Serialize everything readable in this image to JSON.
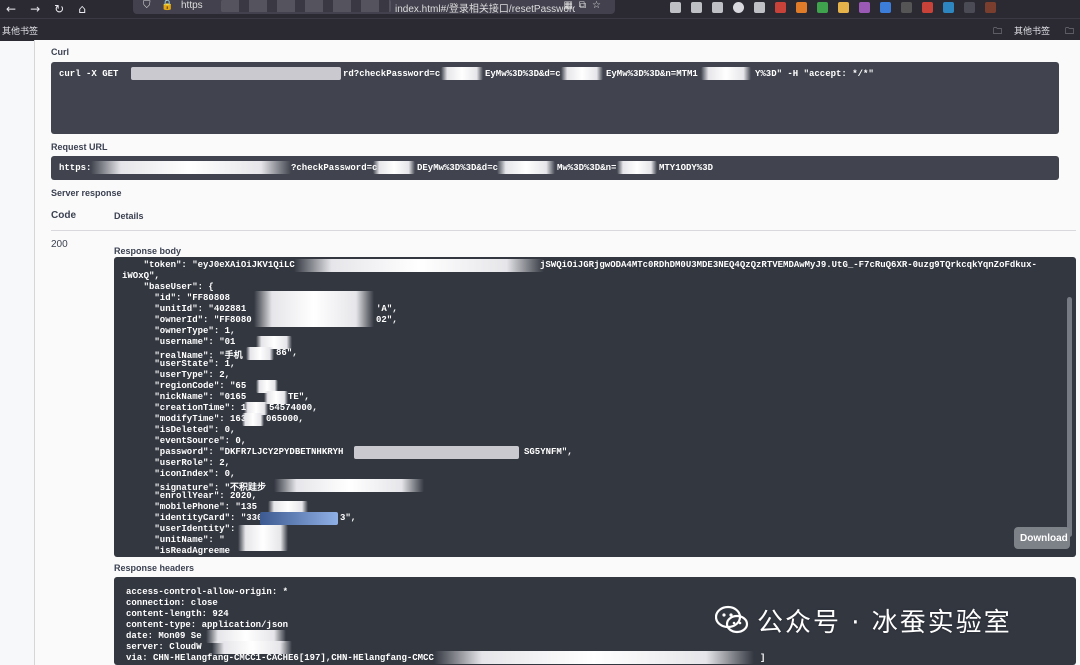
{
  "browser": {
    "nav": {
      "back": "←",
      "forward": "→",
      "reload": "↻",
      "home": "⌂"
    },
    "url_scheme": "https",
    "url_path": "index.html#/登录相关接口/resetPasswordUsi"
  },
  "bookmarks": {
    "left_label": "其他书签",
    "right_label": "其他书签"
  },
  "curl": {
    "label": "Curl",
    "cmd_start": "curl -X GET",
    "seg_a": "rd?checkPassword=c",
    "seg_b": "EyMw%3D%3D&d=c",
    "seg_c": "EyMw%3D%3D&n=MTM1",
    "seg_d": "Y%3D\" -H \"accept: */*\""
  },
  "request_url": {
    "label": "Request URL",
    "scheme": "https:",
    "seg_a": "?checkPassword=c",
    "seg_b": "DEyMw%3D%3D&d=c",
    "seg_c": "Mw%3D%3D&n=",
    "seg_d": "MTY1ODY%3D"
  },
  "server_response": {
    "label": "Server response",
    "code_header": "Code",
    "details_header": "Details",
    "code": "200",
    "body_label": "Response body",
    "download_label": "Download",
    "headers_label": "Response headers"
  },
  "response_body": {
    "lines": [
      "    \"token\": \"eyJ0eXAiOiJKV1QiLC",
      "iWOxQ\",",
      "    \"baseUser\": {",
      "      \"id\": \"FF80808",
      "      \"unitId\": \"402881",
      "      \"ownerId\": \"FF8080",
      "      \"ownerType\": 1,",
      "      \"username\": \"01",
      "      \"realName\": \"手机",
      "      \"userState\": 1,",
      "      \"userType\": 2,",
      "      \"regionCode\": \"65",
      "      \"nickName\": \"0165",
      "      \"creationTime\": 1",
      "      \"modifyTime\": 163",
      "      \"isDeleted\": 0,",
      "      \"eventSource\": 0,",
      "      \"password\": \"DKFR7LJCY2PYDBETNHKRYH",
      "      \"userRole\": 2,",
      "      \"iconIndex\": 0,",
      "      \"signature\": \"不积跬步",
      "      \"enrollYear\": 2020,",
      "      \"mobilePhone\": \"135",
      "      \"identityCard\": \"330",
      "      \"userIdentity\": ",
      "      \"unitName\": \"",
      "      \"isReadAgreeme"
    ],
    "token_tail": "jSWQiOiJGRjgwODA4MTc0RDhDM0U3MDE3NEQ4QzQzRTVEMDAwMyJ9.UtG_-F7cRuQ6XR-0uzg9TQrkcqkYqnZoFdkux-",
    "unitId_tail": "'A\",",
    "ownerId_tail": "02\",",
    "realName_tail": "86\",",
    "nickName_tail": "TE\",",
    "creationTime_tail": "54574000,",
    "modifyTime_tail": "065000,",
    "password_tail": "SG5YNFM\",",
    "identityCard_tail": "3\","
  },
  "response_headers": {
    "lines": [
      "access-control-allow-origin: *",
      "connection: close",
      "content-length: 924",
      "content-type: application/json",
      "date: Mon09 Se",
      "server: CloudW",
      "via: CHN-HElangfang-CMCC1-CACHE6[197],CHN-HElangfang-CMCC"
    ],
    "via_tail": "]"
  },
  "watermark": {
    "text": "公众号 · 冰蚕实验室"
  }
}
